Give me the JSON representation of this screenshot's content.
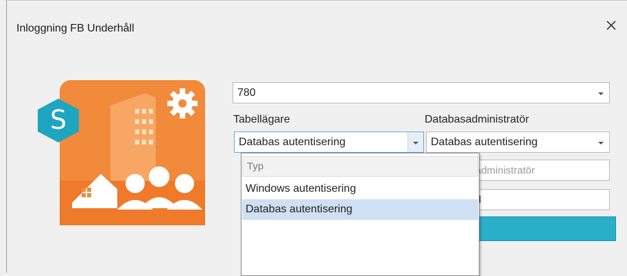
{
  "window": {
    "title": "Inloggning FB Underhåll",
    "close_icon": "close-icon"
  },
  "logo": {
    "letter": "S",
    "colors": {
      "orange": "#f18a3a",
      "teal": "#1ea6c0",
      "cream": "#ffe9d4"
    }
  },
  "server_combo": {
    "value": "780"
  },
  "owner": {
    "label": "Tabellägare",
    "value": "Databas autentisering"
  },
  "dbadmin": {
    "label": "Databasadministratör",
    "value": "Databas autentisering",
    "username_placeholder": "administratör",
    "password_placeholder": "d"
  },
  "dropdown": {
    "header": "Typ",
    "items": [
      {
        "label": "Windows autentisering",
        "selected": false
      },
      {
        "label": "Databas autentisering",
        "selected": true
      }
    ]
  },
  "colors": {
    "accent": "#2aafc8",
    "selection": "#cfe0f5"
  }
}
